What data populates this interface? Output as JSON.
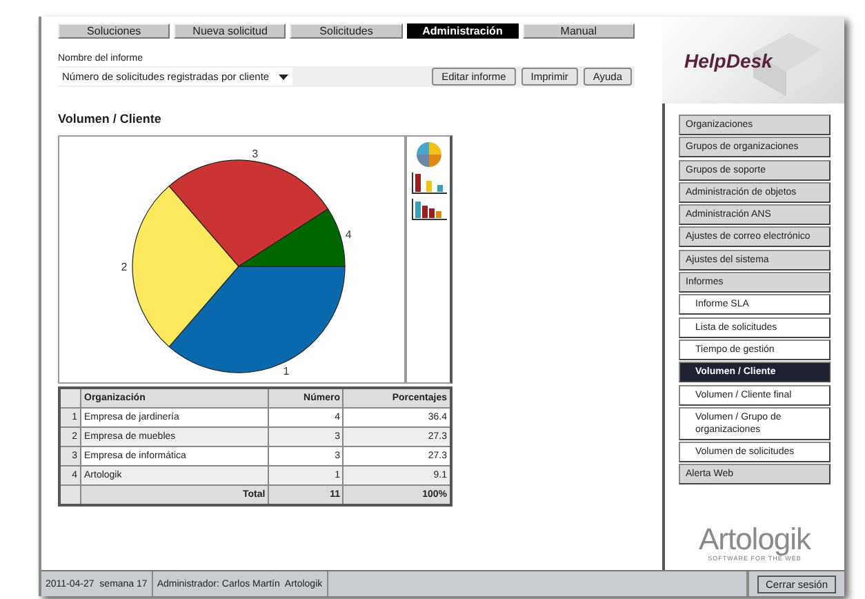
{
  "tabs": [
    {
      "label": "Soluciones",
      "selected": false
    },
    {
      "label": "Nueva solicitud",
      "selected": false
    },
    {
      "label": "Solicitudes",
      "selected": false
    },
    {
      "label": "Administración",
      "selected": true
    },
    {
      "label": "Manual",
      "selected": false
    }
  ],
  "report": {
    "label": "Nombre del informe",
    "value": "Número de solicitudes registradas por cliente"
  },
  "buttons": [
    "Editar informe",
    "Imprimir",
    "Ayuda"
  ],
  "logo": "HelpDesk",
  "title": "Volumen / Cliente",
  "chart": {
    "chart_data": {
      "type": "pie",
      "categories": [
        "1",
        "2",
        "3",
        "4"
      ],
      "values": [
        4,
        3,
        3,
        1
      ]
    }
  },
  "table": {
    "columns": [
      "Organización",
      "Número",
      "Porcentajes"
    ],
    "rows": [
      {
        "index": "1",
        "name": "Empresa de jardinería",
        "count": "4",
        "percent": "36.4"
      },
      {
        "index": "2",
        "name": "Empresa de muebles",
        "count": "3",
        "percent": "27.3"
      },
      {
        "index": "3",
        "name": "Empresa de informática",
        "count": "3",
        "percent": "27.3"
      },
      {
        "index": "4",
        "name": "Artologik",
        "count": "1",
        "percent": "9.1"
      }
    ],
    "total": {
      "label": "Total",
      "count": "11",
      "percent": "100%"
    }
  },
  "menu": [
    {
      "label": "Organizaciones",
      "selected": false
    },
    {
      "label": "Grupos de organizaciones",
      "selected": false
    },
    {
      "label": "Grupos de soporte",
      "selected": false
    },
    {
      "label": "Administración de objetos",
      "selected": false
    },
    {
      "label": "Administración ANS",
      "selected": false
    },
    {
      "label": "Ajustes de correo electrónico",
      "selected": false
    },
    {
      "label": "Ajustes del sistema",
      "selected": false
    },
    {
      "label": "Informes",
      "selected": false,
      "children": [
        {
          "label": "Informe SLA",
          "selected": false
        },
        {
          "label": "Lista de solicitudes",
          "selected": false
        },
        {
          "label": "Tiempo de gestión",
          "selected": false
        },
        {
          "label": "Volumen / Cliente",
          "selected": true
        },
        {
          "label": "Volumen / Cliente final",
          "selected": false
        },
        {
          "label": "Volumen / Grupo de organizaciones",
          "selected": false
        },
        {
          "label": "Volumen de solicitudes",
          "selected": false
        }
      ]
    },
    {
      "label": "Alerta Web",
      "selected": false
    }
  ],
  "brand": {
    "name": "Artologik",
    "tagline": "SOFTWARE FOR THE WEB"
  },
  "status_bar": {
    "date": "2011-04-27  semana 17",
    "user": "Administrador: Carlos Martín  Artologik",
    "logout": "Cerrar sesión"
  }
}
